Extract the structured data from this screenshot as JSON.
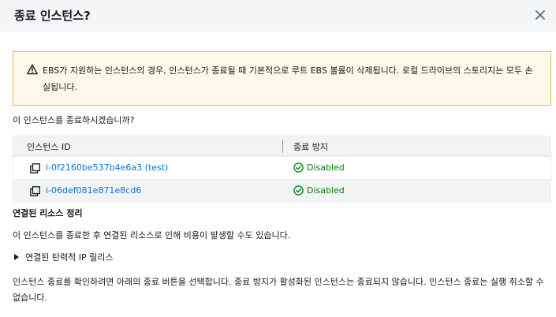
{
  "dialog": {
    "title": "종료 인스턴스?",
    "close_icon": "close-icon"
  },
  "warning": {
    "icon": "warning-icon",
    "text": "EBS가 지원하는 인스턴스의 경우, 인스턴스가 종료될 때 기본적으로 루트 EBS 볼륨이 삭제됩니다. 로컬 드라이브의 스토리지는 모두 손실됩니다."
  },
  "question": "이 인스턴스를 종료하시겠습니까?",
  "table": {
    "headers": [
      "인스턴스 ID",
      "종료 방지"
    ],
    "rows": [
      {
        "instance_id": "i-0f2160be537b4e6a3 (test)",
        "protection": "Disabled"
      },
      {
        "instance_id": "i-06def081e871e8cd6",
        "protection": "Disabled"
      }
    ]
  },
  "resources": {
    "title": "연결된 리소스 정리",
    "description": "이 인스턴스를 종료한 후 연결된 리소스로 인해 비용이 발생할 수도 있습니다.",
    "expander_label": "연결된 탄력적 IP 릴리스"
  },
  "confirm_text": "인스턴스 종료를 확인하려면 아래의 종료 버튼을 선택합니다. 종료 방지가 활성화된 인스턴스는 종료되지 않습니다. 인스턴스 종료는 실행 취소할 수 없습니다.",
  "colors": {
    "link": "#0972d3",
    "success": "#037f0c",
    "warning_border": "#e2b85c",
    "warning_bg": "#fef8e8"
  }
}
